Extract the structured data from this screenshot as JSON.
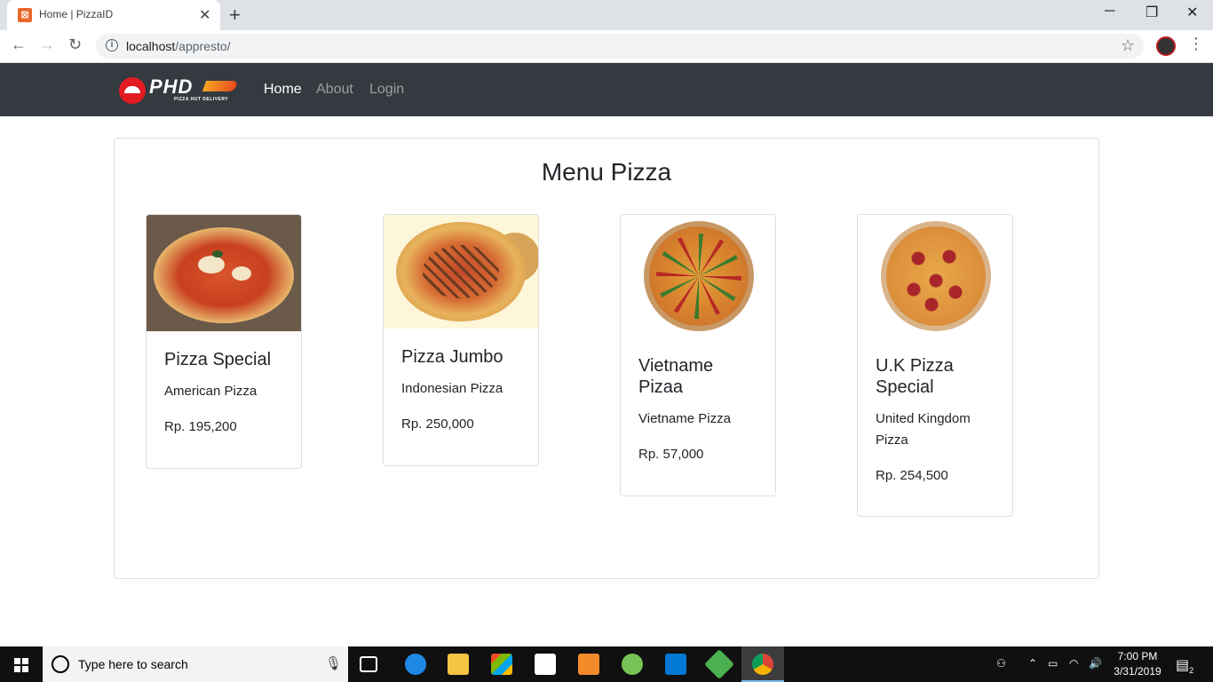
{
  "browser": {
    "tab_title": "Home | PizzaID",
    "tab_close": "✕",
    "new_tab": "+",
    "url_host": "localhost",
    "url_path": "/appresto/",
    "back": "←",
    "forward": "→",
    "reload": "↻",
    "star": "☆",
    "menu": "⋮",
    "minimize": "─",
    "restore": "❐",
    "close": "✕"
  },
  "navbar": {
    "brand_text": "PHD",
    "brand_sub": "PIZZA HUT DELIVERY",
    "links": [
      {
        "label": "Home",
        "active": true
      },
      {
        "label": "About",
        "active": false
      },
      {
        "label": "Login",
        "active": false
      }
    ]
  },
  "menu": {
    "title": "Menu Pizza",
    "items": [
      {
        "name": "Pizza Special",
        "desc": "American Pizza",
        "price": "Rp. 195,200"
      },
      {
        "name": "Pizza Jumbo",
        "desc": "Indonesian Pizza",
        "price": "Rp. 250,000"
      },
      {
        "name": "Vietname Pizaa",
        "desc": "Vietname Pizza",
        "price": "Rp. 57,000"
      },
      {
        "name": "U.K Pizza Special",
        "desc": "United Kingdom Pizza",
        "price": "Rp. 254,500"
      }
    ]
  },
  "taskbar": {
    "search_placeholder": "Type here to search",
    "time": "7:00 PM",
    "date": "3/31/2019",
    "notification_count": "2"
  },
  "colors": {
    "navbar_bg": "#343a40",
    "brand_red": "#e31b23",
    "taskbar_bg": "#101010"
  }
}
